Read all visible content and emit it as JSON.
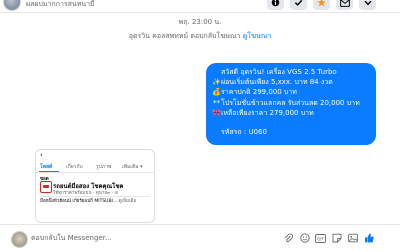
{
  "header": {
    "page_name": "ผลผบมากการสนหนามี",
    "buttons": [
      {
        "icon": "info-icon"
      },
      {
        "icon": "check-icon"
      },
      {
        "icon": "star-icon"
      },
      {
        "icon": "mail-icon"
      },
      {
        "icon": "chevron-down-icon"
      }
    ]
  },
  "conversation": {
    "timestamp": "พฤ. 23:00 น.",
    "notice_text": "อุดรวิน คอลสพทหม์ ตอบกลับโฆษณา",
    "notice_link": "ดูโฆษณา"
  },
  "message": {
    "lines": [
      {
        "emoji": "",
        "text": "สวัสดี อุดรวิน! เครื่อง VGS 2.5 Turbo"
      },
      {
        "emoji": "✨",
        "text": "ผ่อนเริ่มต้นเพียง 5,xxx. บาท 84 งวด"
      },
      {
        "emoji": "💰",
        "text": "ราคาปกติ 299,000 บาท"
      },
      {
        "emoji": "**",
        "text": "โปรโมชั่นข้าวแลกคล รับส่วนลด 20,000 บาท"
      },
      {
        "emoji": "🎀",
        "text": "เหลือเพียงราคา 279,000 บาท"
      },
      {
        "emoji": "",
        "text": ""
      },
      {
        "emoji": "",
        "text": "รหัสรถ : U060"
      }
    ]
  },
  "shared_card": {
    "tabs": [
      "โพสต์",
      "เกี่ยวกับ",
      "รูปภาพ",
      "เพิ่มเติม ▾"
    ],
    "section_label": "ชอด",
    "page_title": "รถยนต์มือสอง โชคคุณโชค",
    "page_sub": "ให้ทุกราคาพร้อมขน · ตุนาย๓ · ⊘",
    "post_text": "มือหนึ่งหัวฮ้อนน์ เกียร์ผมปกิ่ MITSUBI...",
    "post_more": "ดูเพิ่มเติม"
  },
  "composer": {
    "placeholder": "ตอบกลับใน Messenger...",
    "icons": [
      "attach-icon",
      "emoji-icon",
      "gif-icon",
      "sticker-icon",
      "image-icon",
      "like-icon"
    ]
  },
  "colors": {
    "accent": "#0a7cff",
    "header_button_bg": "#e4e6eb",
    "star": "#f7931e"
  }
}
